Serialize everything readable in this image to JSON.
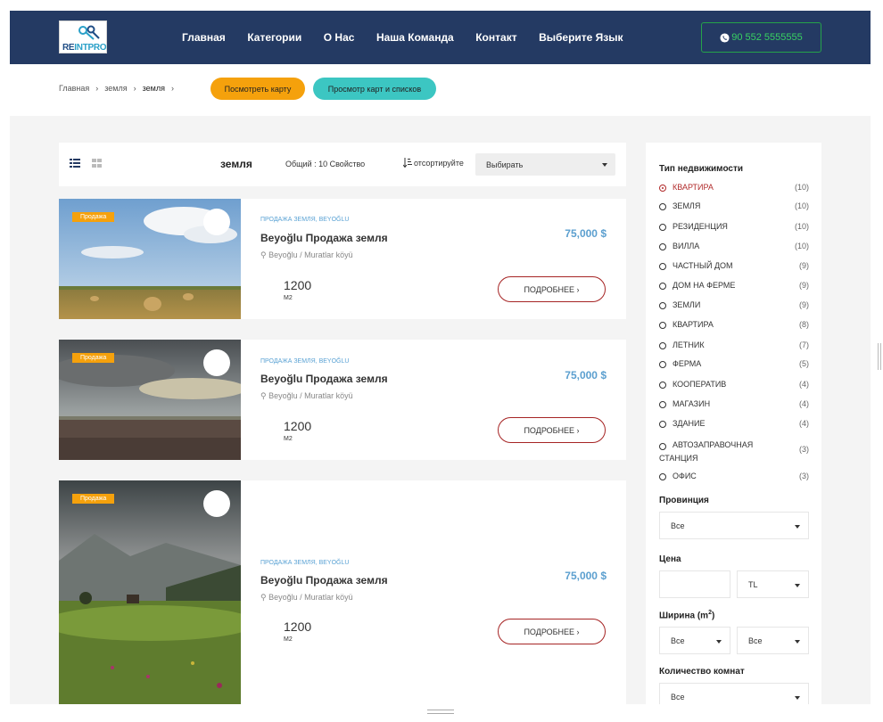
{
  "header": {
    "logo": {
      "re": "RE",
      "in": "INTPRO"
    },
    "nav": [
      "Главная",
      "Категории",
      "О Нас",
      "Наша Команда",
      "Контакт",
      "Выберите Язык"
    ],
    "phone": "90 552 5555555",
    "phone_icon": "whatsapp-icon"
  },
  "breadcrumb": {
    "items": [
      "Главная",
      "земля",
      "земля"
    ],
    "separator": "›"
  },
  "actions": {
    "map_label": "Посмотреть карту",
    "list_label": "Просмотр карт и списков",
    "map_color": "#f5a10c",
    "list_color": "#3cc6c2"
  },
  "toolbar": {
    "title": "земля",
    "total": "Общий : 10 Свойство",
    "sort_label": "отсортируйте",
    "sort_value": "Выбирать"
  },
  "listings": [
    {
      "badge": "Продажа",
      "category": "ПРОДАЖА ЗЕМЛЯ, BEYOĞLU",
      "title": "Beyoğlu Продажа земля",
      "location": "Beyoğlu / Muratlar köyü",
      "price": "75,000 $",
      "area": "1200",
      "unit": "M2",
      "more": "ПОДРОБНЕЕ ›"
    },
    {
      "badge": "Продажа",
      "category": "ПРОДАЖА ЗЕМЛЯ, BEYOĞLU",
      "title": "Beyoğlu Продажа земля",
      "location": "Beyoğlu / Muratlar köyü",
      "price": "75,000 $",
      "area": "1200",
      "unit": "M2",
      "more": "ПОДРОБНЕЕ ›"
    },
    {
      "badge": "Продажа",
      "category": "ПРОДАЖА ЗЕМЛЯ, BEYOĞLU",
      "title": "Beyoğlu Продажа земля",
      "location": "Beyoğlu / Muratlar köyü",
      "price": "75,000 $",
      "area": "1200",
      "unit": "M2",
      "more": "ПОДРОБНЕЕ ›"
    }
  ],
  "sidebar": {
    "type_heading": "Тип недвижимости",
    "types": [
      {
        "label": "КВАРТИРА",
        "count": "(10)",
        "selected": true
      },
      {
        "label": "ЗЕМЛЯ",
        "count": "(10)"
      },
      {
        "label": "РЕЗИДЕНЦИЯ",
        "count": "(10)"
      },
      {
        "label": "ВИЛЛА",
        "count": "(10)"
      },
      {
        "label": "ЧАСТНЫЙ ДОМ",
        "count": "(9)"
      },
      {
        "label": "ДОМ НА ФЕРМЕ",
        "count": "(9)"
      },
      {
        "label": "ЗЕМЛИ",
        "count": "(9)"
      },
      {
        "label": "КВАРТИРА",
        "count": "(8)"
      },
      {
        "label": "ЛЕТНИК",
        "count": "(7)"
      },
      {
        "label": "ФЕРМА",
        "count": "(5)"
      },
      {
        "label": "КООПЕРАТИВ",
        "count": "(4)"
      },
      {
        "label": "МАГАЗИН",
        "count": "(4)"
      },
      {
        "label": "ЗДАНИЕ",
        "count": "(4)"
      },
      {
        "label": "АВТОЗАПРАВОЧНАЯ СТАНЦИЯ",
        "count": "(3)"
      },
      {
        "label": "ОФИС",
        "count": "(3)"
      }
    ],
    "province_heading": "Провинция",
    "province_value": "Все",
    "price_heading": "Цена",
    "price_value": "",
    "currency": "TL",
    "width_heading": "Ширина (m",
    "width_sup": "2",
    "width_close": ")",
    "width_from": "Все",
    "width_to": "Все",
    "rooms_heading": "Количество комнат",
    "rooms_value": "Все"
  }
}
